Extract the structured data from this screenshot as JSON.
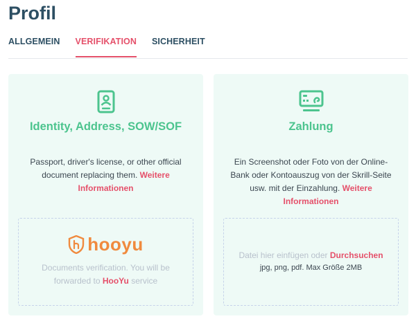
{
  "page": {
    "title": "Profil"
  },
  "tabs": [
    {
      "label": "ALLGEMEIN",
      "active": false
    },
    {
      "label": "VERIFIKATION",
      "active": true
    },
    {
      "label": "SICHERHEIT",
      "active": false
    }
  ],
  "colors": {
    "accent_green": "#4cc48e",
    "accent_red": "#e5506a",
    "title_blue": "#2d4f63",
    "card_bg": "#eefaf6",
    "hooyu_orange": "#f08a3e"
  },
  "identity_card": {
    "icon": "id-document-icon",
    "title": "Identity, Address, SOW/SOF",
    "description": "Passport, driver's license, or other official document replacing them.",
    "more_link": "Weitere Informationen",
    "hooyu": {
      "logo_text": "hooyu",
      "logo_icon": "hooyu-shield-icon",
      "description": "Documents verification. You will be forwarded to",
      "link": "HooYu",
      "suffix": "service"
    }
  },
  "payment_card": {
    "icon": "payment-card-icon",
    "title": "Zahlung",
    "description": "Ein Screenshot oder Foto von der Online-Bank oder Kontoauszug von der Skrill-Seite usw. mit der Einzahlung.",
    "more_link": "Weitere Informationen",
    "upload": {
      "prompt": "Datei hier einfügen oder",
      "browse_link": "Durchsuchen",
      "hint": "jpg, png, pdf. Max Größe 2MB"
    }
  }
}
